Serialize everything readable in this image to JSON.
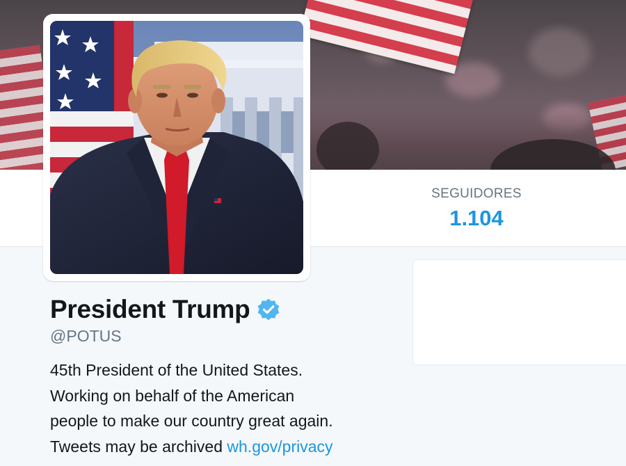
{
  "profile": {
    "name": "President Trump",
    "handle": "@POTUS",
    "bio_lines": [
      "45th President of the United States.",
      "Working on behalf of the American",
      "people to make our country great again.",
      "Tweets may be archived "
    ],
    "bio_link": "wh.gov/privacy",
    "verified": true
  },
  "stats": {
    "followers_label": "SEGUIDORES",
    "followers_value": "1.104"
  },
  "icons": {
    "verified": "verified-badge-icon"
  },
  "colors": {
    "link": "#1b95e0",
    "verified": "#50b5f0",
    "background": "#f5f8fa"
  }
}
